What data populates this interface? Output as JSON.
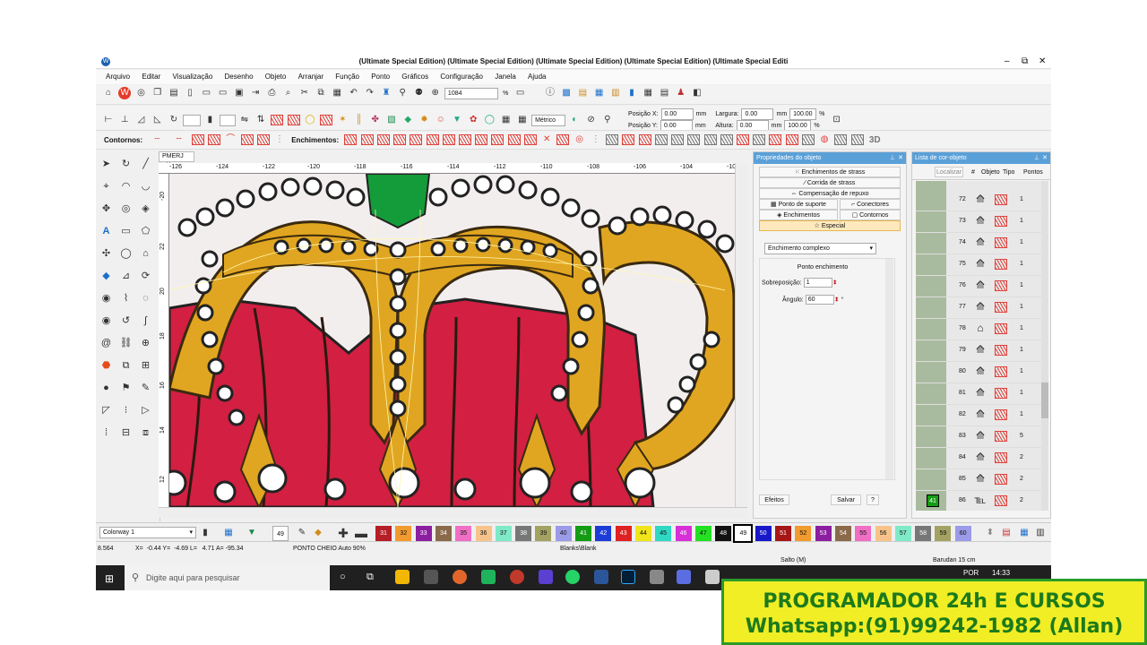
{
  "window": {
    "title": "(Ultimate Special Edition) (Ultimate Special Edition) (Ultimate Special Edition) (Ultimate Special Edition) (Ultimate Special Editi",
    "minimize": "–",
    "maximize": "⧉",
    "close": "✕"
  },
  "menu": [
    "Arquivo",
    "Editar",
    "Visualização",
    "Desenho",
    "Objeto",
    "Arranjar",
    "Função",
    "Ponto",
    "Gráficos",
    "Configuração",
    "Janela",
    "Ajuda"
  ],
  "toolbar": {
    "zoom_value": "1084",
    "zoom_unit": "%",
    "units_value": "Métrico",
    "pos_x_label": "Posição X:",
    "pos_x_value": "0.00",
    "pos_y_label": "Posição Y:",
    "pos_y_value": "0.00",
    "pos_unit": "mm",
    "width_label": "Largura:",
    "width_value": "0.00",
    "height_label": "Altura:",
    "height_value": "0.00",
    "size_unit": "mm",
    "width_pct": "100.00",
    "height_pct": "100.00",
    "pct_unit": "%",
    "contornos_label": "Contornos:",
    "enchimentos_label": "Enchimentos:",
    "three_d": "3D"
  },
  "document": {
    "tab_label": "PMERJ",
    "tab_close": "✕",
    "ruler_h": [
      "-126",
      "-124",
      "-122",
      "-120",
      "-118",
      "-116",
      "-114",
      "-112",
      "-110",
      "-108",
      "-106",
      "-104",
      "-10"
    ],
    "ruler_v": [
      "-20",
      "22",
      "20",
      "18",
      "16",
      "14",
      "12"
    ]
  },
  "properties": {
    "title": "Propriedades do objeto",
    "btn_strass_fill": "Enchimentos de strass",
    "btn_strass_run": "Corrida de strass",
    "btn_comp": "Compensação de repuxo",
    "tab_support": "Ponto de suporte",
    "tab_connectors": "Conectores",
    "tab_fills": "Enchimentos",
    "tab_outlines": "Contornos",
    "tab_special": "Especial",
    "fill_type": "Enchimento complexo",
    "section": "Ponto enchimento",
    "overlap_label": "Sobreposição:",
    "overlap_value": "1",
    "angle_label": "Ângulo:",
    "angle_value": "60",
    "angle_unit": "°",
    "effects_btn": "Efeitos",
    "save_btn": "Salvar",
    "help_btn": "?"
  },
  "object_list": {
    "title": "Lista de cor-objeto",
    "locate_btn": "Localizar",
    "headers": [
      "#",
      "Objeto",
      "Tipo",
      "Pontos"
    ],
    "rows": [
      "72",
      "73",
      "74",
      "75",
      "76",
      "77",
      "78",
      "79",
      "80",
      "81",
      "82",
      "83",
      "84",
      "85",
      "86"
    ],
    "points": [
      "1",
      "1",
      "1",
      "1",
      "1",
      "1",
      "1",
      "1",
      "1",
      "1",
      "1",
      "5",
      "2",
      "2",
      "2"
    ],
    "selected_color": "41"
  },
  "palette": {
    "colorway": "Colorway 1",
    "current": "49",
    "colors": [
      {
        "n": "31",
        "c": "#b61e26"
      },
      {
        "n": "32",
        "c": "#f29a2e"
      },
      {
        "n": "33",
        "c": "#8c1ea0"
      },
      {
        "n": "34",
        "c": "#8a6a4a"
      },
      {
        "n": "35",
        "c": "#f06ec4"
      },
      {
        "n": "36",
        "c": "#f8c38a"
      },
      {
        "n": "37",
        "c": "#7fe9c8"
      },
      {
        "n": "38",
        "c": "#777777"
      },
      {
        "n": "39",
        "c": "#a4a262"
      },
      {
        "n": "40",
        "c": "#9b9be8"
      },
      {
        "n": "41",
        "c": "#149c14"
      },
      {
        "n": "42",
        "c": "#1c3cd8"
      },
      {
        "n": "43",
        "c": "#e02121"
      },
      {
        "n": "44",
        "c": "#f0e41a"
      },
      {
        "n": "45",
        "c": "#30d8c4"
      },
      {
        "n": "46",
        "c": "#d82fd8"
      },
      {
        "n": "47",
        "c": "#22e022"
      },
      {
        "n": "48",
        "c": "#111111"
      },
      {
        "n": "49",
        "c": "#ffffff"
      },
      {
        "n": "50",
        "c": "#1818c8"
      },
      {
        "n": "51",
        "c": "#a61616"
      },
      {
        "n": "52",
        "c": "#f29a2e"
      },
      {
        "n": "53",
        "c": "#8c1ea0"
      },
      {
        "n": "54",
        "c": "#8a6a4a"
      },
      {
        "n": "55",
        "c": "#f06ec4"
      },
      {
        "n": "56",
        "c": "#f8c38a"
      },
      {
        "n": "57",
        "c": "#7fe9c8"
      },
      {
        "n": "58",
        "c": "#777777"
      },
      {
        "n": "59",
        "c": "#a4a262"
      },
      {
        "n": "60",
        "c": "#9b9be8"
      }
    ]
  },
  "status": {
    "zoom": "8.564",
    "coords": "X=  -0.44 Y=  -4.69 L=   4.71 A= -95.34",
    "stitch": "PONTO CHEIO Auto 90%",
    "fabric": "Blanks\\Blank",
    "jump": "Salto (M)",
    "hoop": "Barudan 15 cm"
  },
  "taskbar": {
    "search": "Digite aqui para pesquisar",
    "lang": "POR",
    "time": "14:33"
  },
  "banner": {
    "line1": "PROGRAMADOR 24h E CURSOS",
    "line2": "Whatsapp:(91)99242-1982 (Allan)"
  }
}
